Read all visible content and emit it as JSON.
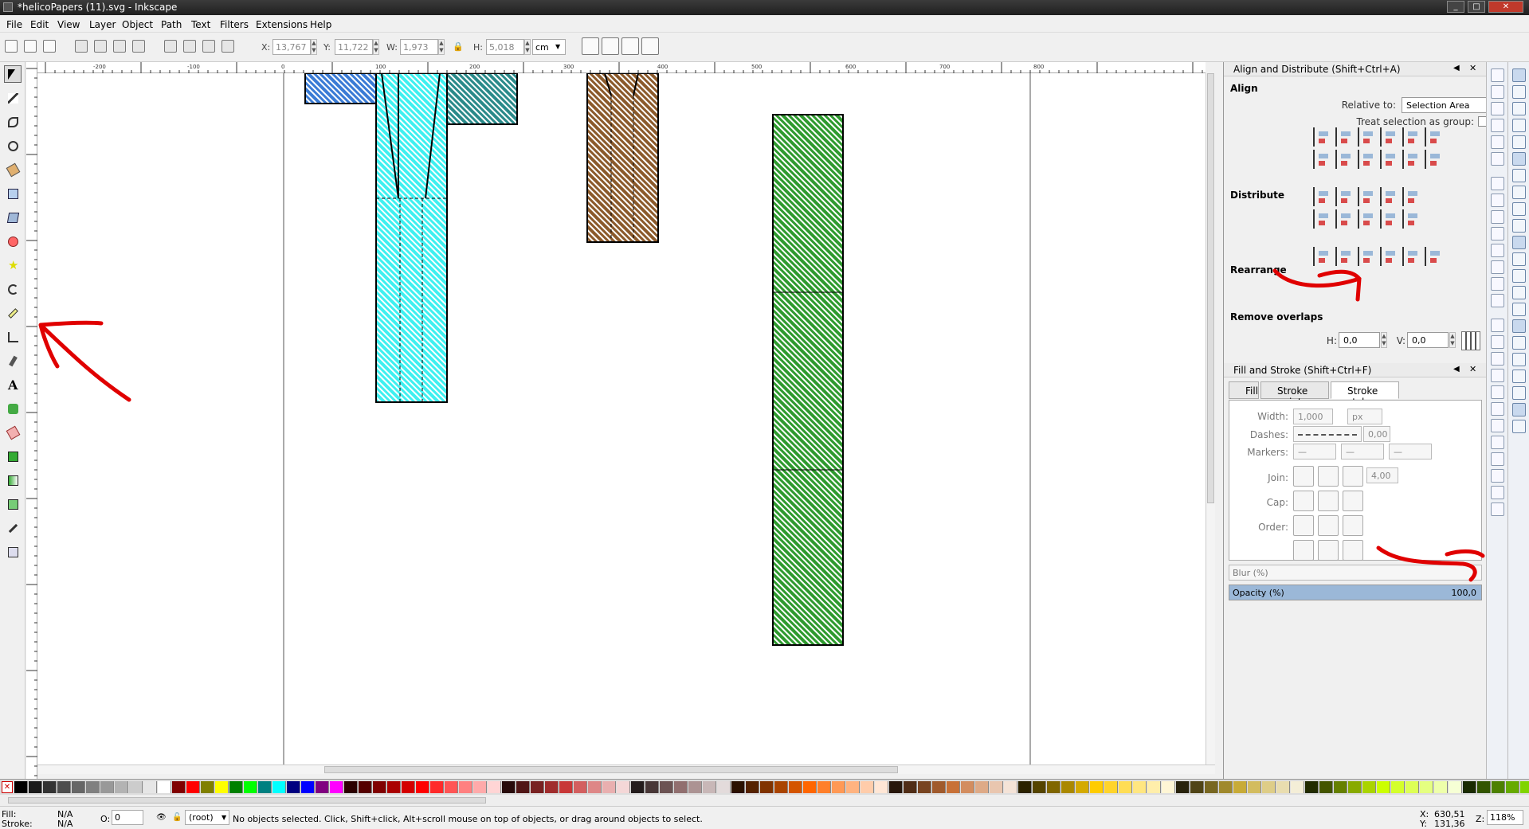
{
  "window": {
    "title": "*helicoPapers (11).svg - Inkscape"
  },
  "menu": [
    "File",
    "Edit",
    "View",
    "Layer",
    "Object",
    "Path",
    "Text",
    "Filters",
    "Extensions",
    "Help"
  ],
  "toolbar": {
    "x_label": "X:",
    "x_value": "13,767",
    "y_label": "Y:",
    "y_value": "11,722",
    "w_label": "W:",
    "w_value": "1,973",
    "h_label": "H:",
    "h_value": "5,018",
    "unit": "cm"
  },
  "ruler": {
    "h_ticks": [
      "-200",
      "-100",
      "0",
      "100",
      "200",
      "300",
      "400",
      "500",
      "600",
      "700",
      "800"
    ]
  },
  "align_panel": {
    "title": "Align and Distribute (Shift+Ctrl+A)",
    "align_heading": "Align",
    "relative_to_label": "Relative to:",
    "relative_to_value": "Selection Area",
    "treat_group_label": "Treat selection as group:",
    "distribute_heading": "Distribute",
    "rearrange_heading": "Rearrange",
    "remove_overlaps_heading": "Remove overlaps",
    "h_label": "H:",
    "h_value": "0,0",
    "v_label": "V:",
    "v_value": "0,0"
  },
  "fill_stroke_panel": {
    "title": "Fill and Stroke (Shift+Ctrl+F)",
    "tabs": [
      "Fill",
      "Stroke paint",
      "Stroke style"
    ],
    "width_label": "Width:",
    "width_value": "1,000",
    "width_unit": "px",
    "dashes_label": "Dashes:",
    "dashes_value": "0,00",
    "markers_label": "Markers:",
    "join_label": "Join:",
    "miter_value": "4,00",
    "cap_label": "Cap:",
    "order_label": "Order:",
    "blur_label": "Blur (%)",
    "opacity_label": "Opacity (%)",
    "opacity_value": "100,0",
    "opacity_level": 100
  },
  "status": {
    "fill_label": "Fill:",
    "fill_value": "N/A",
    "stroke_label": "Stroke:",
    "stroke_value": "N/A",
    "o_label": "O:",
    "o_value": "0",
    "layer": "(root)",
    "message": "No objects selected. Click, Shift+click, Alt+scroll mouse on top of objects, or drag around objects to select.",
    "x_label": "X:",
    "x_value": "630,51",
    "y_label": "Y:",
    "y_value": "131,36",
    "z_label": "Z:",
    "zoom": "118%"
  },
  "colors": {
    "cyan_pattern": "#3ef0f0",
    "teal_pattern": "#2a8a8a",
    "blue_pattern": "#3a7bd5",
    "brown_pattern": "#8b5a2b",
    "green_pattern": "#2e9a2e",
    "annotation_red": "#e00000"
  }
}
